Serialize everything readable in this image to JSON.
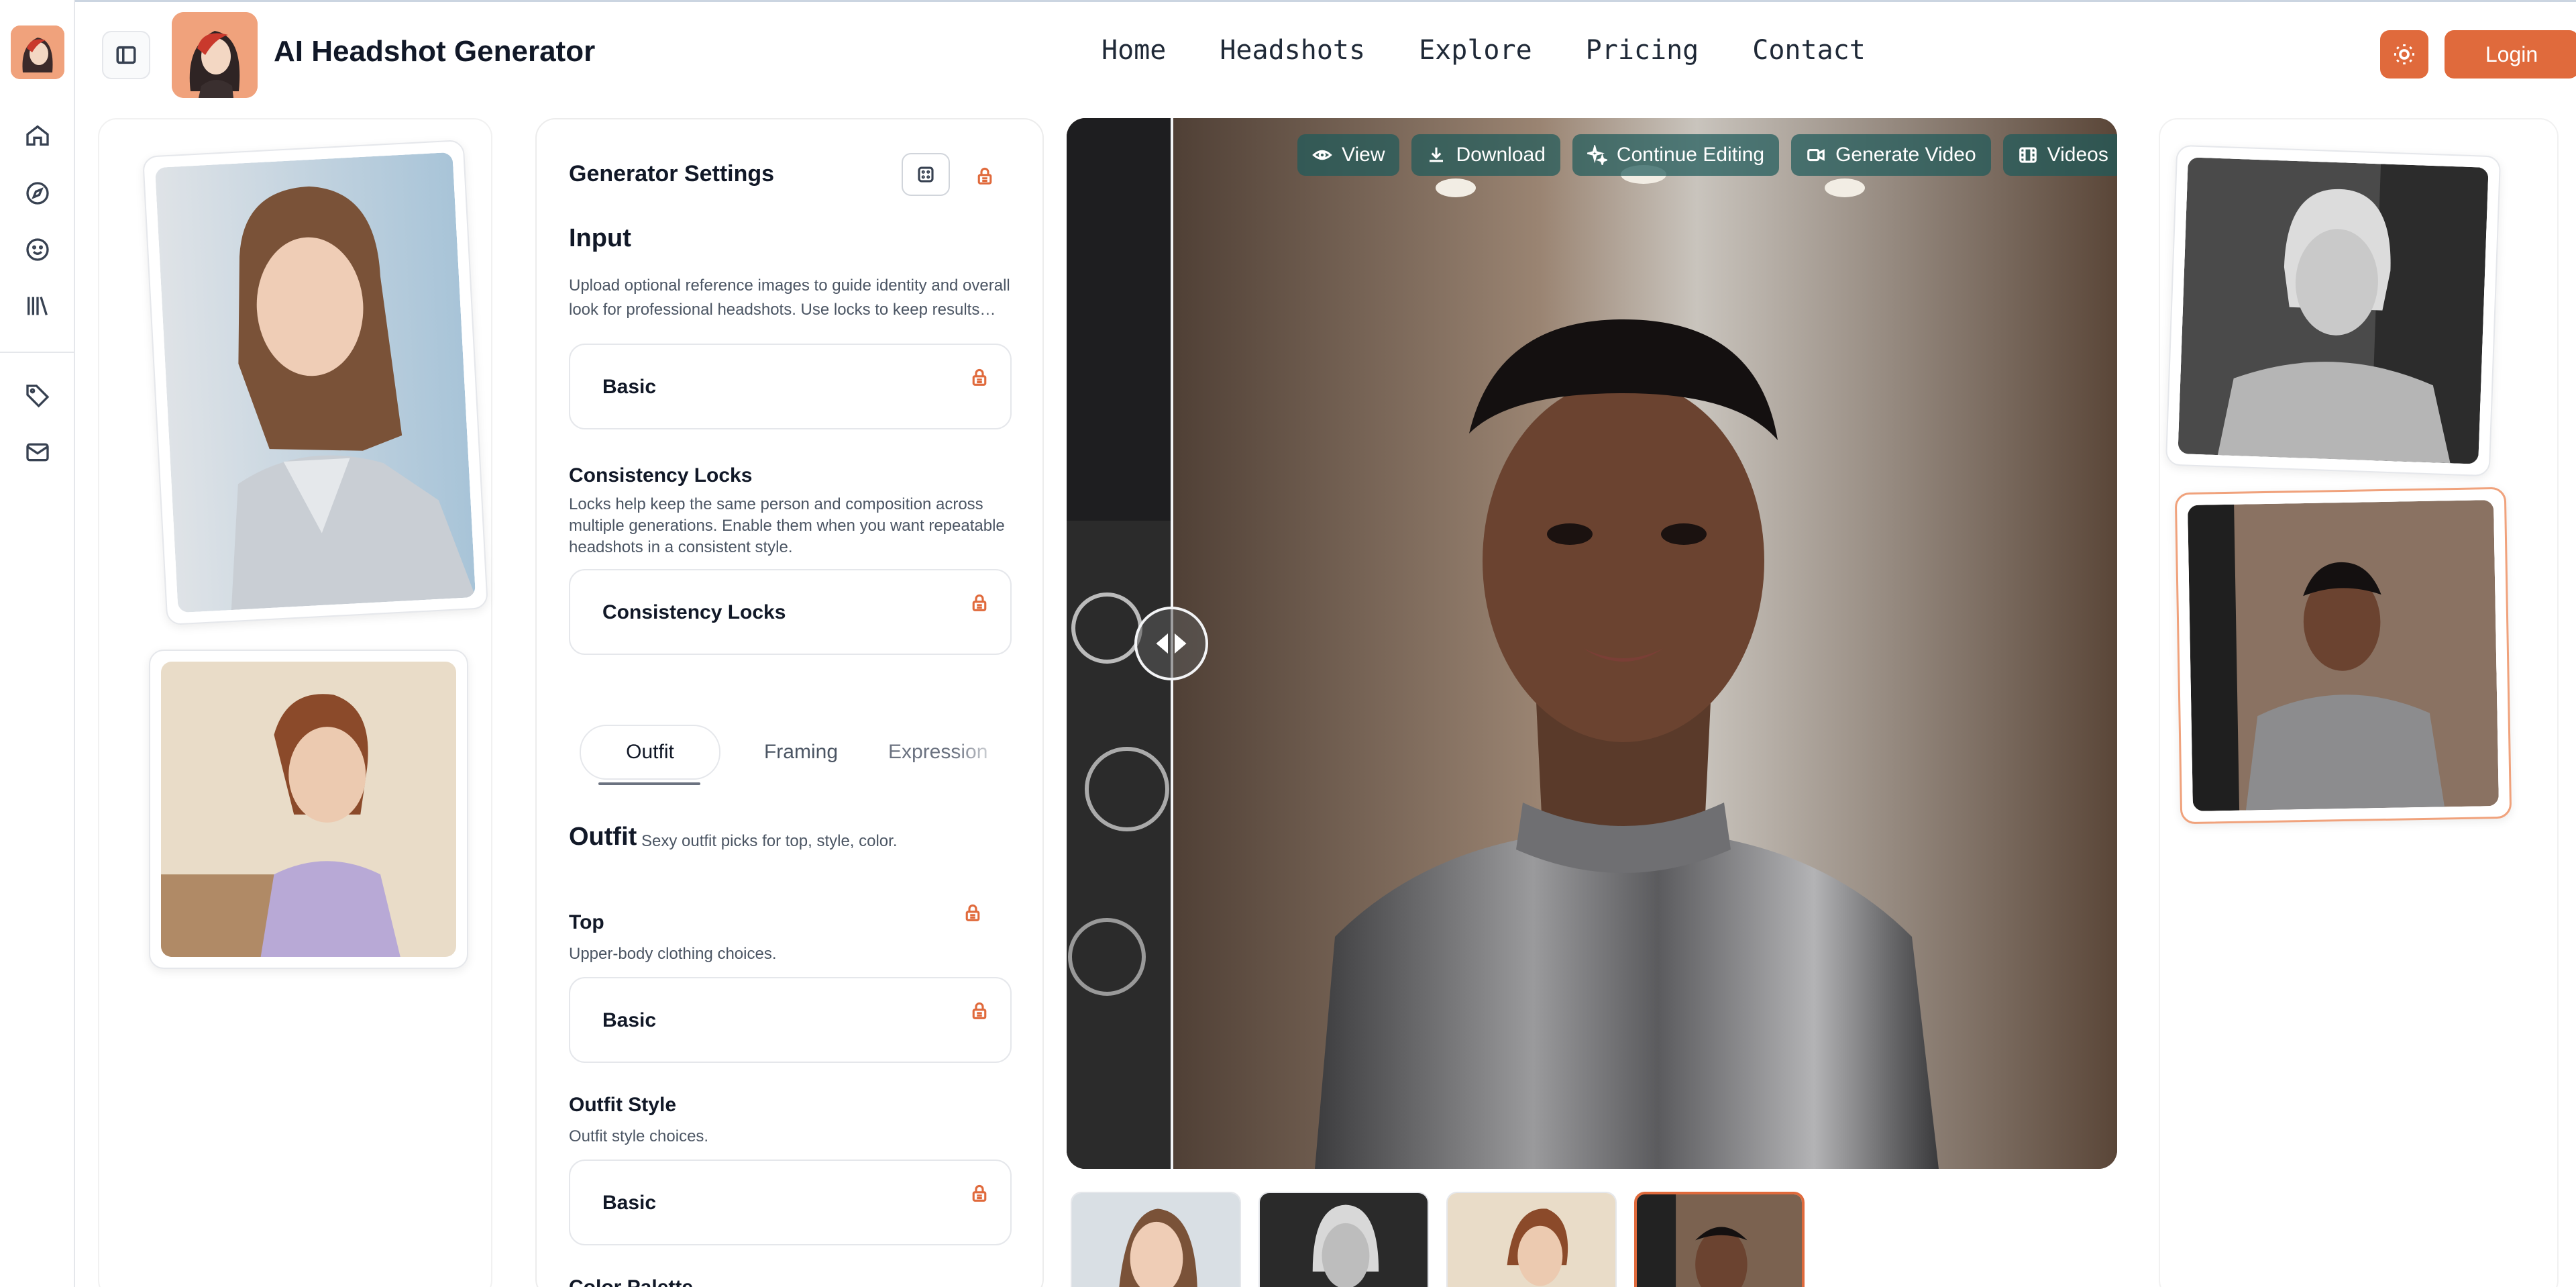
{
  "app": {
    "title": "AI Headshot Generator"
  },
  "nav": {
    "items": [
      "Home",
      "Headshots",
      "Explore",
      "Pricing",
      "Contact"
    ]
  },
  "header": {
    "login_label": "Login"
  },
  "rail": {
    "icons": [
      "home-icon",
      "compass-icon",
      "face-smile-icon",
      "library-icon",
      "tag-icon",
      "mail-icon"
    ]
  },
  "settings": {
    "title": "Generator Settings",
    "input_heading": "Input",
    "input_desc": "Upload optional reference images to guide identity and overall look for professional headshots. Use locks to keep results…",
    "input_box_label": "Basic",
    "locks_heading": "Consistency Locks",
    "locks_desc": "Locks help keep the same person and composition across multiple generations. Enable them when you want repeatable headshots in a consistent style.",
    "locks_box_label": "Consistency Locks",
    "tabs": [
      "Outfit",
      "Framing",
      "Expression"
    ],
    "active_tab": "Outfit",
    "outfit_heading": "Outfit",
    "outfit_sub": "Sexy outfit picks for top, style, color.",
    "top_heading": "Top",
    "top_desc": "Upper-body clothing choices.",
    "top_box_label": "Basic",
    "style_heading": "Outfit Style",
    "style_desc": "Outfit style choices.",
    "style_box_label": "Basic",
    "palette_heading": "Color Palette"
  },
  "viewer": {
    "toolbar": [
      "View",
      "Download",
      "Continue Editing",
      "Generate Video",
      "Videos"
    ]
  },
  "colors": {
    "accent": "#e06a3c",
    "accent_light": "#f0a27c",
    "toolbar_bg": "#1e5a5a"
  }
}
